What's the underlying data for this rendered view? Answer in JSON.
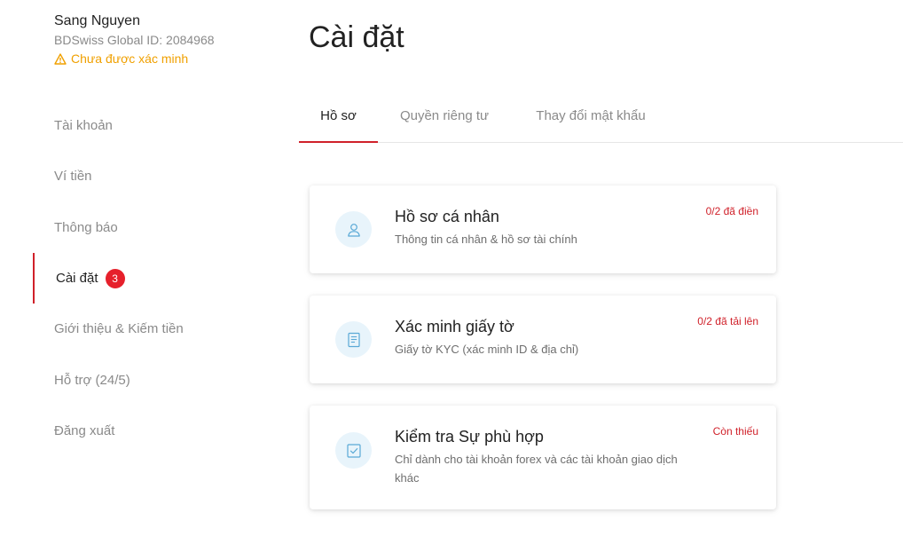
{
  "user": {
    "name": "Sang Nguyen",
    "id_line": "BDSwiss Global ID: 2084968",
    "status": "Chưa được xác minh",
    "status_icon": "warning-icon",
    "status_color": "#f0a000"
  },
  "sidebar": {
    "items": [
      {
        "label": "Tài khoản"
      },
      {
        "label": "Ví tiền"
      },
      {
        "label": "Thông báo"
      },
      {
        "label": "Cài đặt",
        "badge": "3"
      },
      {
        "label": "Giới thiệu & Kiếm tiền"
      },
      {
        "label": "Hỗ trợ (24/5)"
      },
      {
        "label": "Đăng xuất"
      }
    ],
    "active_index": 3
  },
  "page": {
    "title": "Cài đặt"
  },
  "tabs": [
    {
      "label": "Hồ sơ"
    },
    {
      "label": "Quyền riêng tư"
    },
    {
      "label": "Thay đổi mật khẩu"
    }
  ],
  "cards": [
    {
      "title": "Hồ sơ cá nhân",
      "subtitle": "Thông tin cá nhân & hồ sơ tài chính",
      "status": "0/2 đã điền",
      "icon": "user-icon"
    },
    {
      "title": "Xác minh giấy tờ",
      "subtitle": "Giấy tờ KYC (xác minh ID & địa chỉ)",
      "status": "0/2 đã tải lên",
      "icon": "document-icon"
    },
    {
      "title": "Kiểm tra Sự phù hợp",
      "subtitle": "Chỉ dành cho tài khoản forex và các tài khoản giao dịch khác",
      "status": "Còn thiếu",
      "icon": "checkbox-icon"
    }
  ],
  "colors": {
    "accent": "#d0212a",
    "badge": "#e6202b",
    "icon_bg": "#e8f4fb",
    "icon_stroke": "#5aa9d6"
  }
}
